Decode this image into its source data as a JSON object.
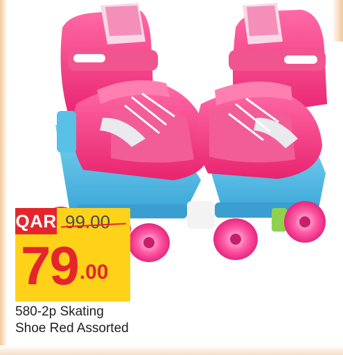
{
  "offer": {
    "currency": "QAR",
    "old_price": "99.00",
    "new_price_whole": "79",
    "new_price_fraction": ".00",
    "product_name_line1": "580-2p Skating",
    "product_name_line2": "Shoe Red Assorted"
  },
  "image": {
    "subject_icon": "roller-skates-icon"
  },
  "colors": {
    "tag_background": "#ffd21a",
    "currency_badge": "#e4252b",
    "price_text": "#e4252b",
    "skate_pink": "#f0347e",
    "skate_blue": "#5cc3e8"
  }
}
